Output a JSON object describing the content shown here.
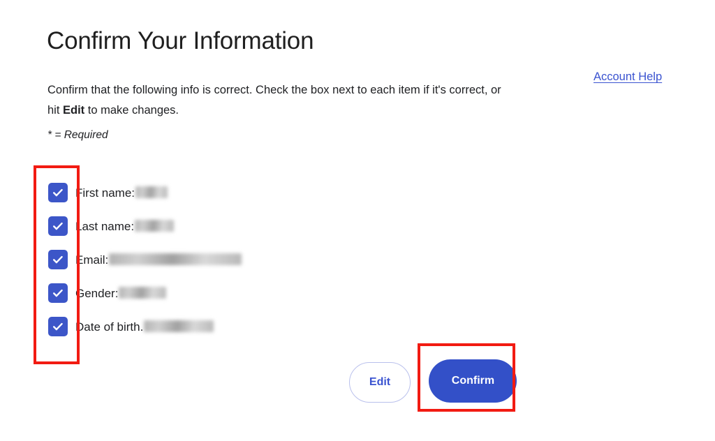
{
  "page": {
    "title": "Confirm Your Information",
    "intro_before_bold": "Confirm that the following info is correct. Check the box next to each item if it's correct, or hit ",
    "intro_bold": "Edit",
    "intro_after_bold": " to make changes.",
    "required_note": "* = Required"
  },
  "account_help": {
    "label": "Account Help",
    "color": "#3a53d0"
  },
  "checklist": {
    "items": [
      {
        "label": "First name:",
        "value": "",
        "checked": true,
        "redacted_width": 46
      },
      {
        "label": "Last name:",
        "value": "",
        "checked": true,
        "redacted_width": 56
      },
      {
        "label": "Email:",
        "value": "",
        "checked": true,
        "redacted_width": 190
      },
      {
        "label": "Gender:",
        "value": "",
        "checked": true,
        "redacted_width": 68
      },
      {
        "label": "Date of birth.",
        "value": "",
        "checked": true,
        "redacted_width": 100
      }
    ]
  },
  "buttons": {
    "edit_label": "Edit",
    "confirm_label": "Confirm",
    "edit_color": "#3a53d0",
    "confirm_bg": "#3350c8"
  },
  "annotations": {
    "highlight_color": "#f21b12",
    "checklist_box": "checkbox-column-highlight",
    "confirm_box": "confirm-button-highlight"
  },
  "theme": {
    "checkbox_fill": "#3c56c8",
    "background": "#ffffff",
    "text": "#202124"
  }
}
